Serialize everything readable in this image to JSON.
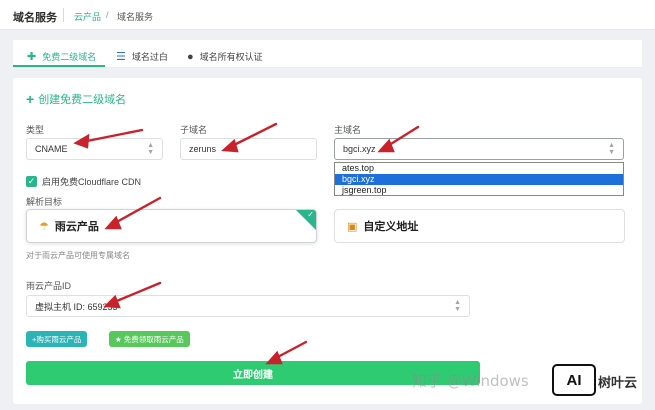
{
  "header": {
    "title": "域名服务",
    "breadcrumb": [
      "云产品",
      "/",
      "域名服务"
    ]
  },
  "tabs": [
    {
      "label": "免费二级域名",
      "icon": "plus-icon",
      "active": true
    },
    {
      "label": "域名过白",
      "icon": "list-icon",
      "active": false
    },
    {
      "label": "域名所有权认证",
      "icon": "user-icon",
      "active": false
    }
  ],
  "form": {
    "section_title": "创建免费二级域名",
    "type": {
      "label": "类型",
      "value": "CNAME"
    },
    "subdomain": {
      "label": "子域名",
      "value": "zeruns"
    },
    "main_domain": {
      "label": "主域名",
      "value": "bgci.xyz",
      "options": [
        "ates.top",
        "bgci.xyz",
        "jsgreen.top"
      ],
      "selected_index": 1
    },
    "cdn_checkbox": {
      "label": "启用免费Cloudflare CDN",
      "checked": true
    },
    "target": {
      "label": "解析目标",
      "option_product": "雨云产品",
      "option_custom": "自定义地址",
      "selected": "雨云产品",
      "hint": "对于雨云产品可使用专属域名"
    },
    "product_id": {
      "label": "雨云产品ID",
      "value": "虚拟主机 ID: 659253"
    },
    "buy_button": "+购买雨云产品",
    "free_button": "免费领取雨云产品",
    "submit_button": "立即创建"
  },
  "watermark": {
    "zhihu": "知乎 @Windows",
    "ai_logo": "AI",
    "brand": "树叶云"
  },
  "colors": {
    "accent": "#2bb58c",
    "submit": "#2ecb72",
    "arrow": "#c8232c",
    "dropdown_selected": "#1e6fd9"
  }
}
